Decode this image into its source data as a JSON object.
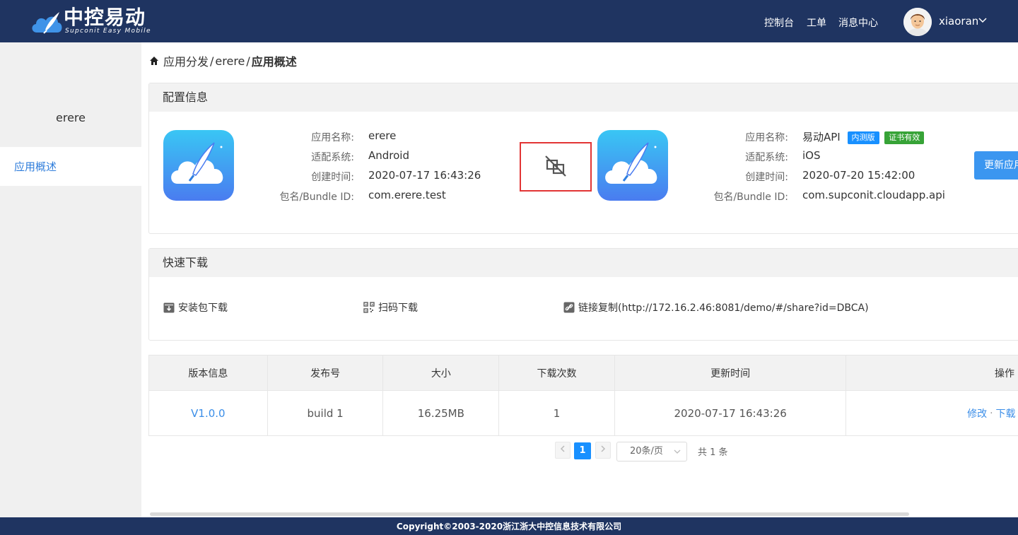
{
  "header": {
    "logo_title": "中控易动",
    "logo_subtitle": "Supconit Easy Mobile",
    "nav": [
      "控制台",
      "工单",
      "消息中心"
    ],
    "username": "xiaoran"
  },
  "sidebar": {
    "app_name": "erere",
    "items": [
      {
        "label": "应用概述",
        "active": true
      }
    ]
  },
  "breadcrumb": [
    "应用分发",
    "erere",
    "应用概述"
  ],
  "config": {
    "title": "配置信息",
    "labels": {
      "name": "应用名称:",
      "os": "适配系统:",
      "created": "创建时间:",
      "bundle": "包名/Bundle ID:"
    },
    "left_app": {
      "name": "erere",
      "os": "Android",
      "created": "2020-07-17 16:43:26",
      "bundle": "com.erere.test"
    },
    "right_app": {
      "name": "易动API",
      "os": "iOS",
      "created": "2020-07-20 15:42:00",
      "bundle": "com.supconit.cloudapp.api",
      "tags": [
        {
          "label": "内测版",
          "color": "#1890ff"
        },
        {
          "label": "证书有效",
          "color": "#37a337"
        }
      ]
    },
    "update_button": "更新应用"
  },
  "quick_download": {
    "title": "快速下载",
    "items": [
      {
        "icon": "package-download-icon",
        "label": "安装包下载"
      },
      {
        "icon": "qrcode-icon",
        "label": "扫码下载"
      },
      {
        "icon": "link-icon",
        "label": "链接复制(http://172.16.2.46:8081/demo/#/share?id=DBCA)"
      }
    ]
  },
  "versions": {
    "headers": [
      "版本信息",
      "发布号",
      "大小",
      "下载次数",
      "更新时间",
      "操作"
    ],
    "rows": [
      {
        "version": "V1.0.0",
        "build": "build 1",
        "size": "16.25MB",
        "downloads": "1",
        "updated": "2020-07-17 16:43:26",
        "actions": [
          "修改",
          "下载"
        ]
      }
    ]
  },
  "pagination": {
    "current": "1",
    "page_size": "20条/页",
    "total": "共 1 条"
  },
  "footer": {
    "copyright": "Copyright©2003-2020浙江浙大中控信息技术有限公司"
  },
  "colors": {
    "header_bg": "#1f3461",
    "accent": "#1890ff",
    "link": "#3b8ee8",
    "highlight_border": "#e23434"
  }
}
